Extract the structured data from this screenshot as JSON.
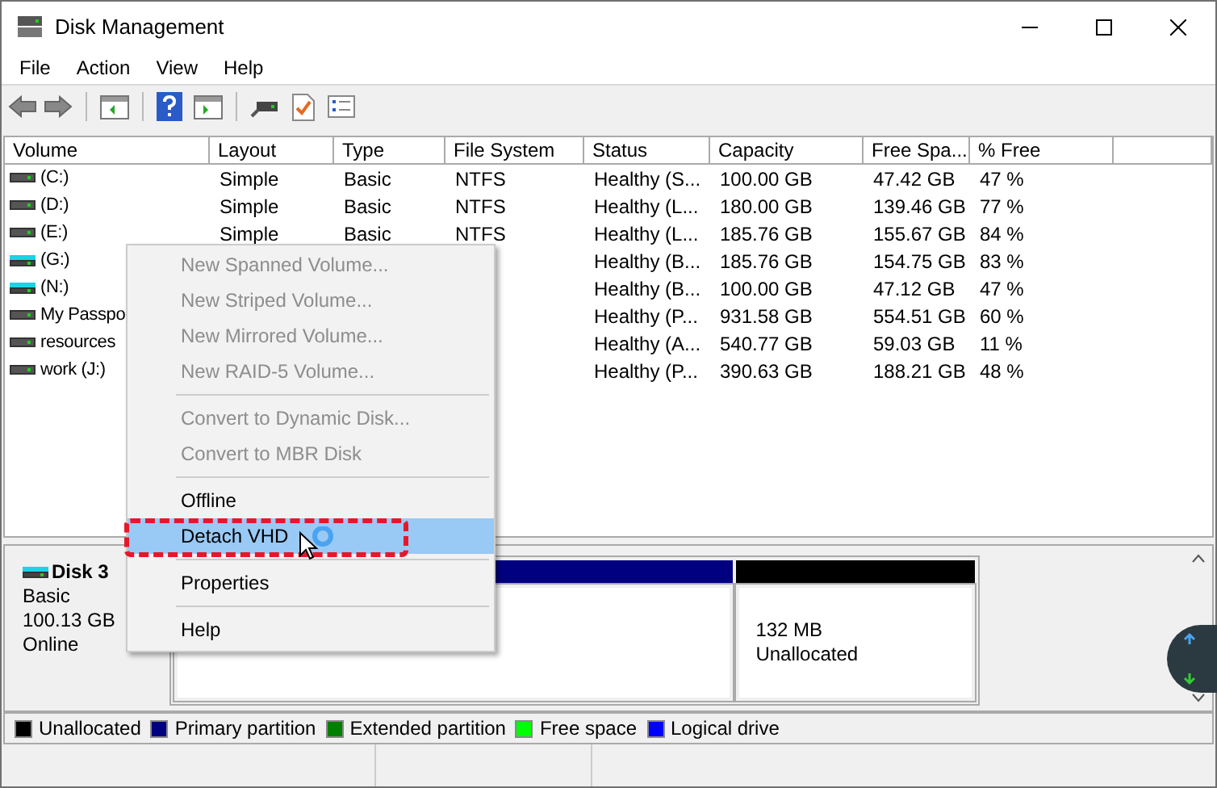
{
  "window": {
    "title": "Disk Management"
  },
  "menu_bar": [
    "File",
    "Action",
    "View",
    "Help"
  ],
  "table": {
    "columns": [
      "Volume",
      "Layout",
      "Type",
      "File System",
      "Status",
      "Capacity",
      "Free Spa...",
      "% Free"
    ],
    "rows": [
      {
        "kind": "fixed",
        "cells": [
          "(C:)",
          "Simple",
          "Basic",
          "NTFS",
          "Healthy (S...",
          "100.00 GB",
          "47.42 GB",
          "47 %"
        ]
      },
      {
        "kind": "fixed",
        "cells": [
          "(D:)",
          "Simple",
          "Basic",
          "NTFS",
          "Healthy (L...",
          "180.00 GB",
          "139.46 GB",
          "77 %"
        ]
      },
      {
        "kind": "fixed",
        "cells": [
          "(E:)",
          "Simple",
          "Basic",
          "NTFS",
          "Healthy (L...",
          "185.76 GB",
          "155.67 GB",
          "84 %"
        ]
      },
      {
        "kind": "virtual",
        "cells": [
          "(G:)",
          null,
          null,
          null,
          "Healthy (B...",
          "185.76 GB",
          "154.75 GB",
          "83 %"
        ]
      },
      {
        "kind": "virtual",
        "cells": [
          "(N:)",
          null,
          null,
          null,
          "Healthy (B...",
          "100.00 GB",
          "47.12 GB",
          "47 %"
        ]
      },
      {
        "kind": "fixed",
        "cells": [
          "My Passpo",
          null,
          null,
          null,
          "Healthy (P...",
          "931.58 GB",
          "554.51 GB",
          "60 %"
        ]
      },
      {
        "kind": "fixed",
        "cells": [
          "resources",
          null,
          null,
          null,
          "Healthy (A...",
          "540.77 GB",
          "59.03 GB",
          "11 %"
        ]
      },
      {
        "kind": "fixed",
        "cells": [
          "work (J:)",
          null,
          null,
          null,
          "Healthy (P...",
          "390.63 GB",
          "188.21 GB",
          "48 %"
        ]
      }
    ]
  },
  "context_menu": {
    "groups": [
      [
        {
          "label": "New Spanned Volume...",
          "disabled": true,
          "selected": false
        },
        {
          "label": "New Striped Volume...",
          "disabled": true,
          "selected": false
        },
        {
          "label": "New Mirrored Volume...",
          "disabled": true,
          "selected": false
        },
        {
          "label": "New RAID-5 Volume...",
          "disabled": true,
          "selected": false
        }
      ],
      [
        {
          "label": "Convert to Dynamic Disk...",
          "disabled": true,
          "selected": false
        },
        {
          "label": "Convert to MBR Disk",
          "disabled": true,
          "selected": false
        }
      ],
      [
        {
          "label": "Offline",
          "disabled": false,
          "selected": false
        },
        {
          "label": "Detach VHD",
          "disabled": false,
          "selected": true
        }
      ],
      [
        {
          "label": "Properties",
          "disabled": false,
          "selected": false
        }
      ],
      [
        {
          "label": "Help",
          "disabled": false,
          "selected": false
        }
      ]
    ]
  },
  "disk": {
    "kind": "virtual",
    "name": "Disk 3",
    "type": "Basic",
    "size": "100.13 GB",
    "status": "Online",
    "partitions": [
      {
        "kind": "primary"
      },
      {
        "kind": "unallocated",
        "lines": [
          "132 MB",
          "Unallocated"
        ]
      }
    ]
  },
  "legend": [
    {
      "label": "Unallocated",
      "color": "#000000"
    },
    {
      "label": "Primary partition",
      "color": "#000080"
    },
    {
      "label": "Extended partition",
      "color": "#008000"
    },
    {
      "label": "Free space",
      "color": "#00ff00"
    },
    {
      "label": "Logical drive",
      "color": "#0000ff"
    }
  ]
}
